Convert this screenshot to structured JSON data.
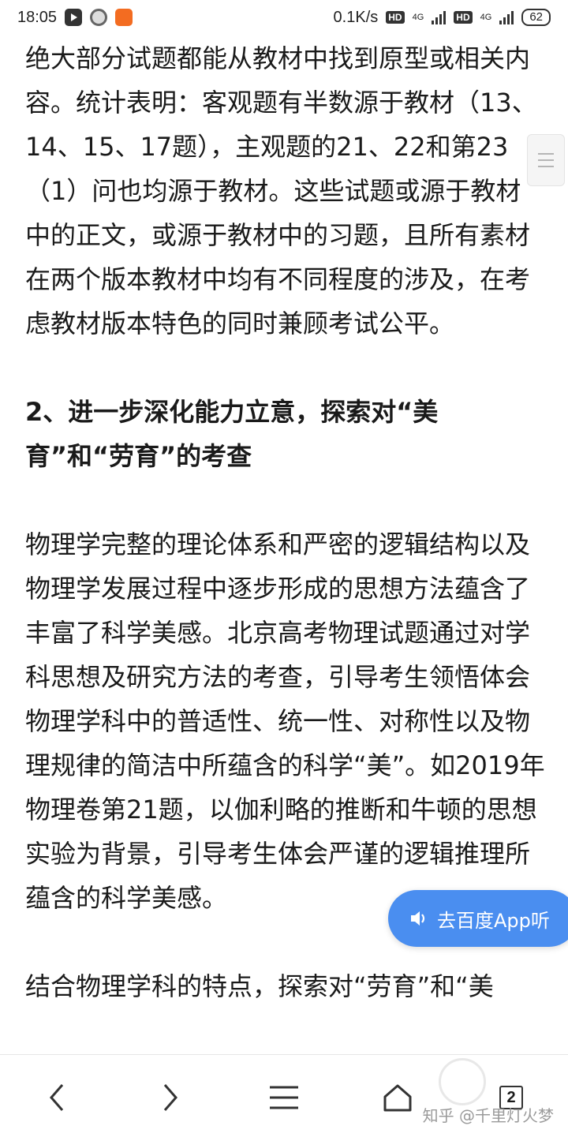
{
  "status_bar": {
    "time": "18:05",
    "net_speed": "0.1K/s",
    "hd1": "HD",
    "net1": "4G",
    "hd2": "HD",
    "net2": "4G",
    "battery": "62"
  },
  "article": {
    "paragraph1": "绝大部分试题都能从教材中找到原型或相关内容。统计表明：客观题有半数源于教材（13、14、15、17题），主观题的21、22和第23（1）问也均源于教材。这些试题或源于教材中的正文，或源于教材中的习题，且所有素材在两个版本教材中均有不同程度的涉及，在考虑教材版本特色的同时兼顾考试公平。",
    "heading": "2、进一步深化能力立意，探索对“美育”和“劳育”的考查",
    "paragraph2": "物理学完整的理论体系和严密的逻辑结构以及物理学发展过程中逐步形成的思想方法蕴含了丰富了科学美感。北京高考物理试题通过对学科思想及研究方法的考查，引导考生领悟体会物理学科中的普适性、统一性、对称性以及物理规律的简洁中所蕴含的科学“美”。如2019年物理卷第21题，以伽利略的推断和牛顿的思想实验为背景，引导考生体会严谨的逻辑推理所蕴含的科学美感。",
    "paragraph3": "结合物理学科的特点，探索对“劳育”和“美"
  },
  "listen_button": {
    "label": "去百度App听"
  },
  "bottom_nav": {
    "tab_count": "2"
  },
  "watermark": "知乎 @千里灯火梦"
}
